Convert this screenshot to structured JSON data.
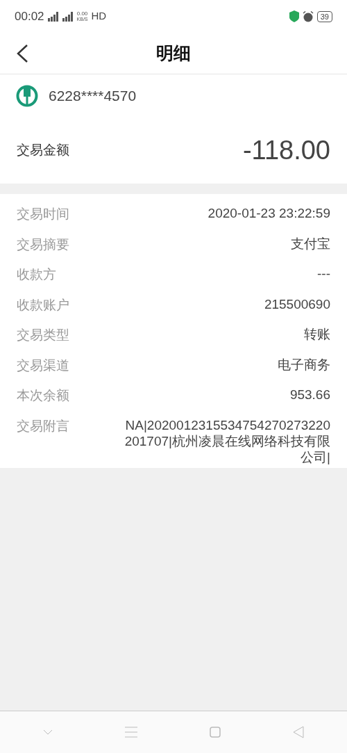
{
  "status_bar": {
    "time": "00:02",
    "net_speed_value": "0.00",
    "net_speed_unit": "KB/S",
    "hd": "HD",
    "battery": "39"
  },
  "header": {
    "title": "明细"
  },
  "card": {
    "number": "6228****4570"
  },
  "amount": {
    "label": "交易金额",
    "value": "-118.00"
  },
  "details": [
    {
      "label": "交易时间",
      "value_lines": [
        "2020-01-23 23:22:59"
      ]
    },
    {
      "label": "交易摘要",
      "value_lines": [
        "支付宝"
      ]
    },
    {
      "label": "收款方",
      "value_lines": [
        "---"
      ]
    },
    {
      "label": "收款账户",
      "value_lines": [
        "215500690"
      ]
    },
    {
      "label": "交易类型",
      "value_lines": [
        "转账"
      ]
    },
    {
      "label": "交易渠道",
      "value_lines": [
        "电子商务"
      ]
    },
    {
      "label": "本次余额",
      "value_lines": [
        "953.66"
      ]
    },
    {
      "label": "交易附言",
      "value_lines": [
        "NA|2020012315534754270273220",
        "201707|杭州凌晨在线网络科技有限",
        "公司|"
      ]
    }
  ]
}
